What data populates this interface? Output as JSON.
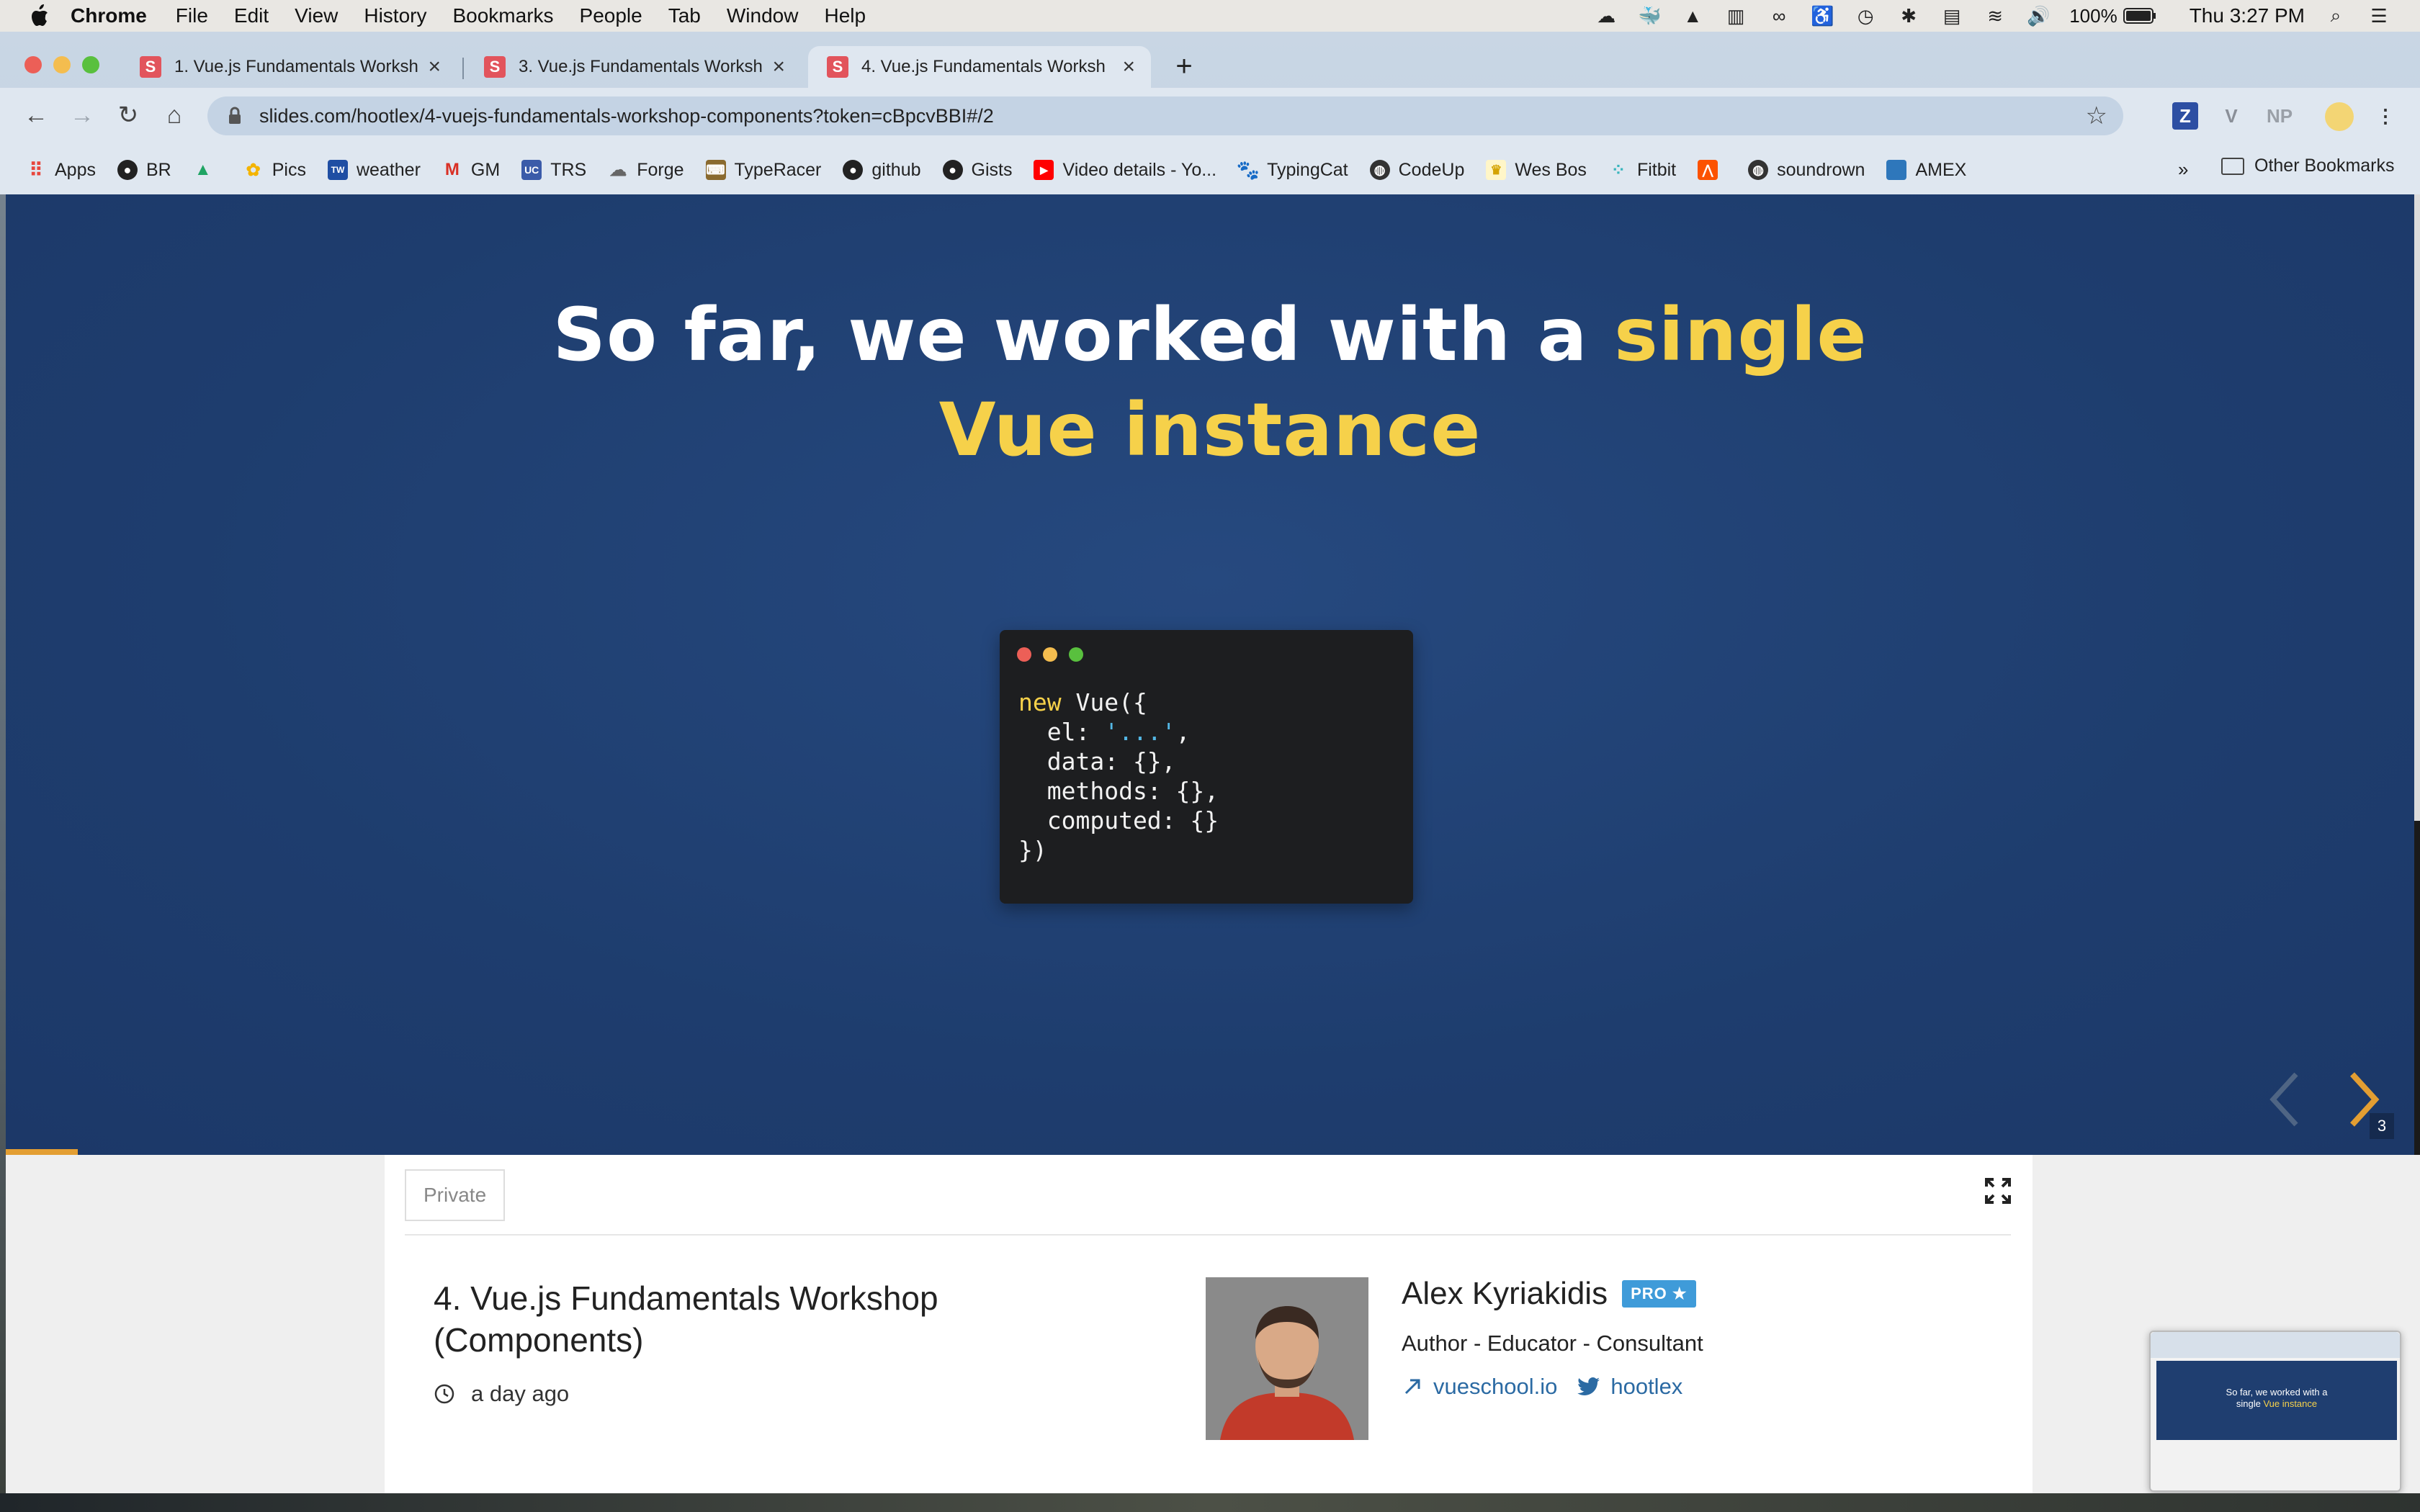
{
  "menubar": {
    "app": "Chrome",
    "items": [
      "File",
      "Edit",
      "View",
      "History",
      "Bookmarks",
      "People",
      "Tab",
      "Window",
      "Help"
    ],
    "battery": "100%",
    "clock": "Thu 3:27 PM"
  },
  "tabs": [
    {
      "title": "1. Vue.js Fundamentals Worksh",
      "favicon": "S"
    },
    {
      "title": "3. Vue.js Fundamentals Worksh",
      "favicon": "S"
    },
    {
      "title": "4. Vue.js Fundamentals Worksh",
      "favicon": "S"
    }
  ],
  "omnibox": {
    "url": "slides.com/hootlex/4-vuejs-fundamentals-workshop-components?token=cBpcvBBI#/2"
  },
  "extensions": [
    "Z",
    "V",
    "NP"
  ],
  "bookmarks": {
    "items": [
      {
        "label": "Apps",
        "icon": "apps-grid-icon",
        "color": "#e8453c"
      },
      {
        "label": "BR",
        "icon": "github-icon",
        "color": "#222222"
      },
      {
        "label": "",
        "icon": "google-drive-icon",
        "color": "#1fa463"
      },
      {
        "label": "Pics",
        "icon": "google-photos-icon",
        "color": "#f4b400"
      },
      {
        "label": "weather",
        "icon": "weather-channel-icon",
        "color": "#1f4ea3"
      },
      {
        "label": "GM",
        "icon": "gmail-icon",
        "color": "#d93025"
      },
      {
        "label": "TRS",
        "icon": "trs-icon",
        "color": "#3b5ba9"
      },
      {
        "label": "Forge",
        "icon": "forge-icon",
        "color": "#666666"
      },
      {
        "label": "TypeRacer",
        "icon": "typeracer-icon",
        "color": "#8a6a2e"
      },
      {
        "label": "github",
        "icon": "github-icon",
        "color": "#222222"
      },
      {
        "label": "Gists",
        "icon": "github-icon",
        "color": "#222222"
      },
      {
        "label": "Video details - Yo...",
        "icon": "youtube-icon",
        "color": "#ff0000"
      },
      {
        "label": "TypingCat",
        "icon": "paw-icon",
        "color": "#222222"
      },
      {
        "label": "CodeUp",
        "icon": "globe-icon",
        "color": "#333333"
      },
      {
        "label": "Wes Bos",
        "icon": "crown-icon",
        "color": "#f5d23c"
      },
      {
        "label": "Fitbit",
        "icon": "fitbit-icon",
        "color": "#39b5bd"
      },
      {
        "label": "",
        "icon": "strava-icon",
        "color": "#fc5200"
      },
      {
        "label": "soundrown",
        "icon": "globe-icon",
        "color": "#333333"
      },
      {
        "label": "AMEX",
        "icon": "amex-icon",
        "color": "#2e77bb"
      }
    ],
    "more": "»",
    "other": "Other Bookmarks"
  },
  "slide": {
    "title_part1": "So far, we worked with a",
    "title_highlight_1": "single",
    "title_highlight_2": "Vue instance",
    "code": {
      "kw": "new",
      "line1_rest": " Vue({",
      "line2_a": "  el: ",
      "line2_str": "'...'",
      "line2_b": ",",
      "line3": "  data: {},",
      "line4": "  methods: {},",
      "line5": "  computed: {}",
      "line6": "})"
    },
    "slide_number": "3",
    "progress": 0.03,
    "colors": {
      "accent": "#f6d14a",
      "bg": "#1e3d6e",
      "nav": "#e39e32"
    }
  },
  "card": {
    "visibility": "Private",
    "deck_title": "4. Vue.js Fundamentals Workshop (Components)",
    "time": "a day ago",
    "author": {
      "name": "Alex Kyriakidis",
      "badge": "PRO ★",
      "role": "Author - Educator - Consultant",
      "website": "vueschool.io",
      "twitter": "hootlex"
    }
  },
  "mini_preview": {
    "line1": "So far, we worked with a",
    "line2_pre": "single ",
    "line2_hl": "Vue instance"
  }
}
